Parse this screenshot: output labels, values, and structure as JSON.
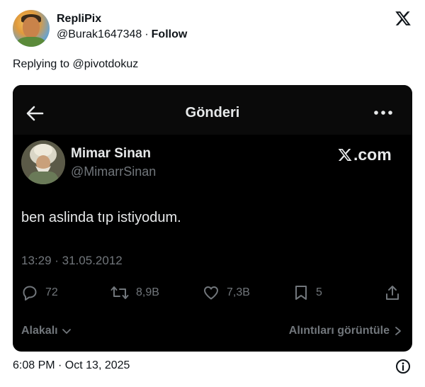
{
  "author": {
    "name": "RepliPix",
    "handle": "@Burak1647348",
    "separator": "·",
    "follow_label": "Follow"
  },
  "reply_to": "Replying to @pivotdokuz",
  "embed": {
    "header_title": "Gönderi",
    "user": {
      "name": "Mimar Sinan",
      "handle": "@MimarrSinan"
    },
    "brand": ".com",
    "text": "ben aslinda tıp istiyodum.",
    "time": "13:29 · 31.05.2012",
    "stats": {
      "replies": "72",
      "reposts": "8,9B",
      "likes": "7,3B",
      "bookmarks": "5"
    },
    "footer_left": "Alakalı",
    "footer_right": "Alıntıları görüntüle"
  },
  "timestamp": "6:08 PM · Oct 13, 2025",
  "colors": {
    "embed_bg": "#000000",
    "muted": "#71767b",
    "text_dark": "#0f1419",
    "text_light": "#e7e9ea"
  }
}
